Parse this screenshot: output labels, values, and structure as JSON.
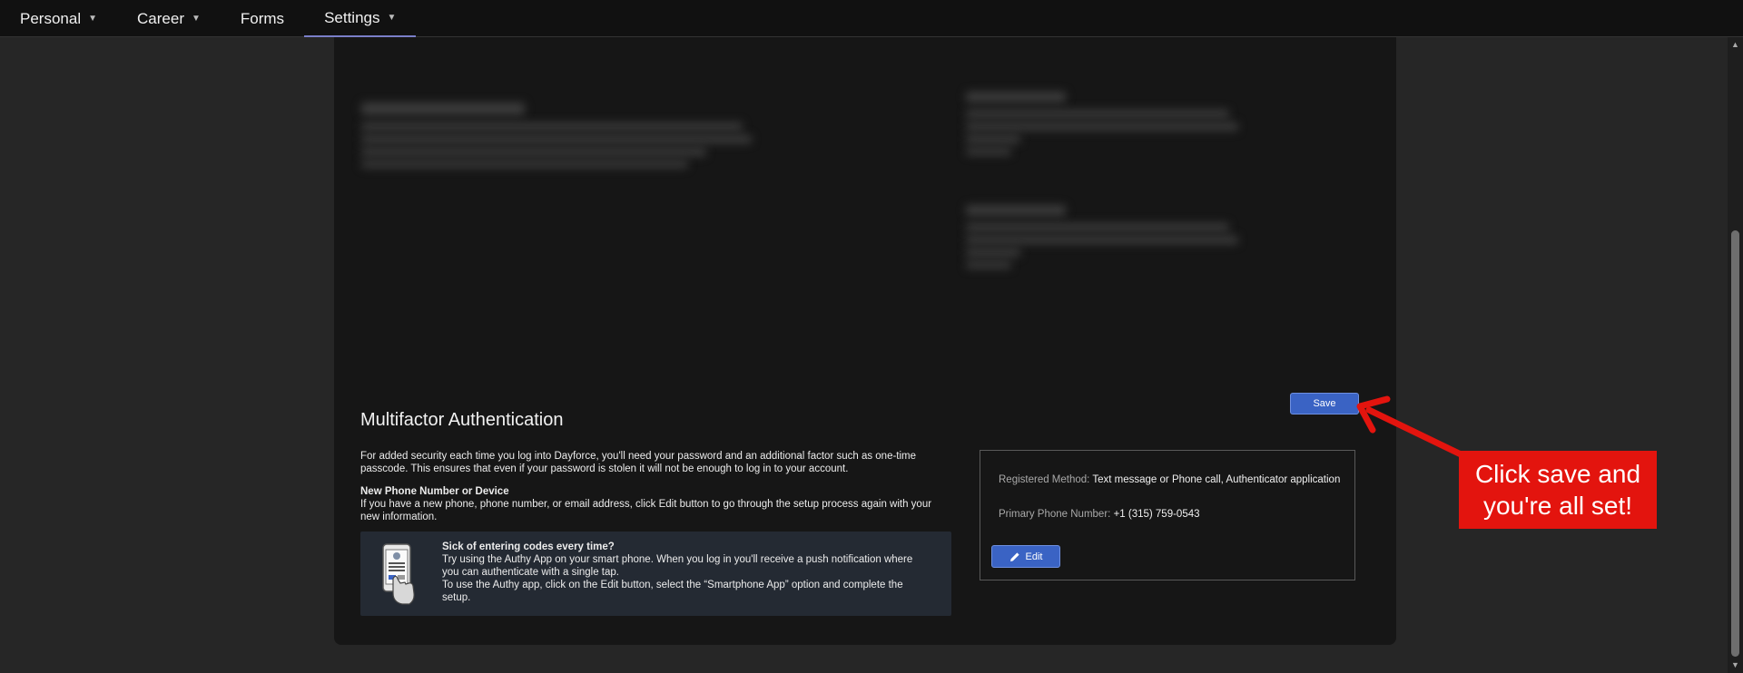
{
  "nav": {
    "items": [
      {
        "label": "Personal",
        "has_dropdown": true
      },
      {
        "label": "Career",
        "has_dropdown": true
      },
      {
        "label": "Forms",
        "has_dropdown": false
      },
      {
        "label": "Settings",
        "has_dropdown": true,
        "active": true
      }
    ]
  },
  "mfa": {
    "title": "Multifactor Authentication",
    "save_label": "Save",
    "intro": "For added security each time you log into Dayforce, you'll need your password and an additional factor such as one-time passcode. This ensures that even if your password is stolen it will not be enough to log in to your account.",
    "new_device_heading": "New Phone Number or Device",
    "new_device_text": "If you have a new phone, phone number, or email address, click Edit button to go through the setup process again with your new information.",
    "authy": {
      "heading": "Sick of entering codes every time?",
      "line1": "Try using the Authy App on your smart phone. When you log in you'll receive a push notification where you can authenticate with a single tap.",
      "line2": "To use the Authy app, click on the Edit button, select the “Smartphone App” option and complete the setup."
    },
    "registered_method_label": "Registered Method:",
    "registered_method_value": "Text message or Phone call, Authenticator application",
    "primary_phone_label": "Primary Phone Number:",
    "primary_phone_value": "+1 (315) 759-0543",
    "edit_label": "Edit"
  },
  "annotation": {
    "line1": "Click save and",
    "line2": "you're all set!"
  },
  "colors": {
    "accent": "#3a63c4",
    "callout": "#e3140e",
    "nav_active_underline": "#7a7fc9"
  }
}
